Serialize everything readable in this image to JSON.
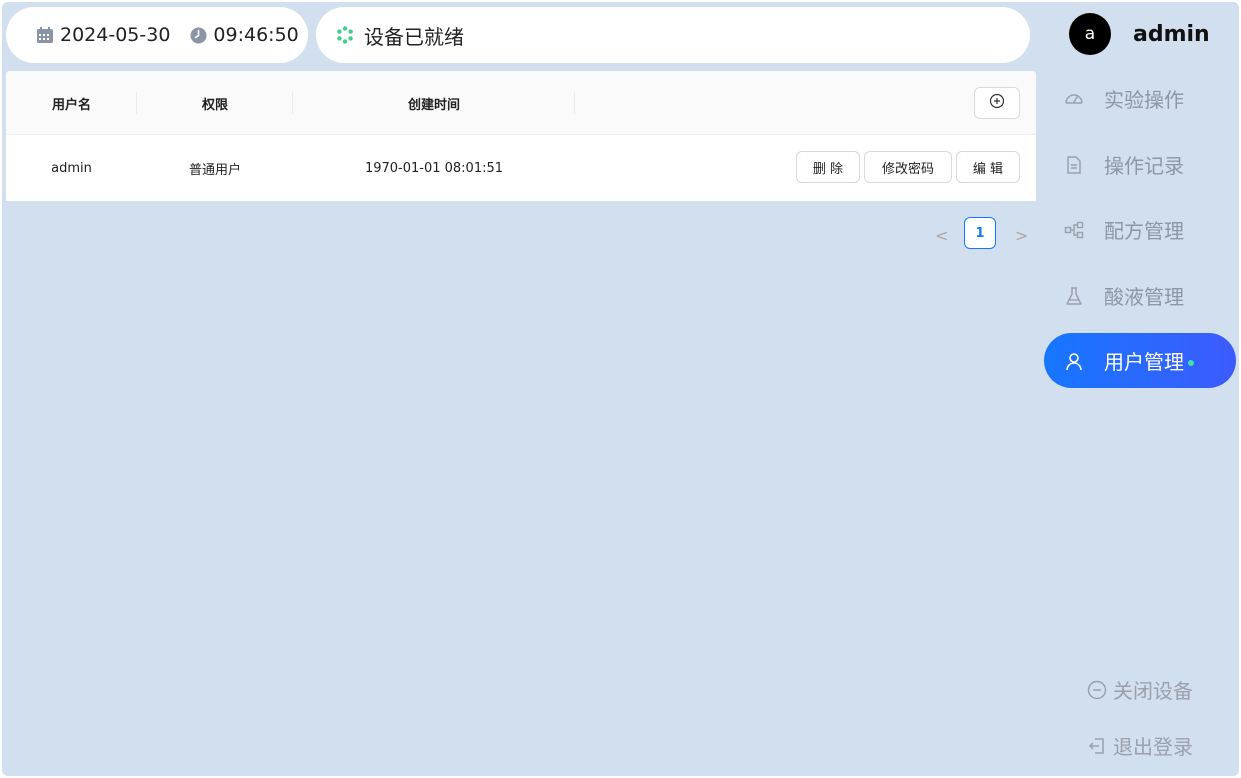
{
  "header": {
    "date": "2024-05-30",
    "time": "09:46:50",
    "status": "设备已就绪",
    "user_avatar_letter": "a",
    "username": "admin"
  },
  "table": {
    "columns": [
      "用户名",
      "权限",
      "创建时间"
    ],
    "rows": [
      {
        "username": "admin",
        "role": "普通用户",
        "created": "1970-01-01 08:01:51",
        "actions": [
          "删 除",
          "修改密码",
          "编 辑"
        ]
      }
    ]
  },
  "pagination": {
    "prev": "<",
    "current": "1",
    "next": ">"
  },
  "sidebar": {
    "items": [
      {
        "label": "实验操作",
        "icon": "dashboard-icon",
        "active": false
      },
      {
        "label": "操作记录",
        "icon": "file-icon",
        "active": false
      },
      {
        "label": "配方管理",
        "icon": "flow-icon",
        "active": false
      },
      {
        "label": "酸液管理",
        "icon": "flask-icon",
        "active": false
      },
      {
        "label": "用户管理",
        "icon": "user-icon",
        "active": true
      }
    ]
  },
  "footer": {
    "shutdown": "关闭设备",
    "logout": "退出登录"
  },
  "colors": {
    "background": "#d2dfee",
    "accent": "#1677ff",
    "status_ok": "#3fcf8e"
  }
}
